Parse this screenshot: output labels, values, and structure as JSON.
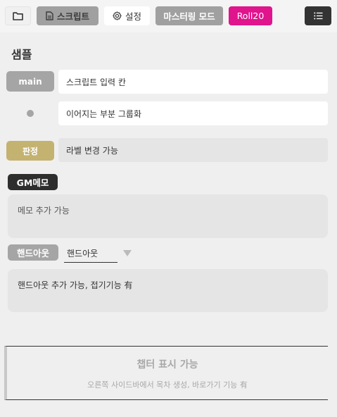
{
  "toolbar": {
    "folder_icon": "folder-icon",
    "script_label": "스크립트",
    "script_icon": "document-icon",
    "settings_label": "설정",
    "settings_icon": "gear-icon",
    "mastering_label": "마스터링 모드",
    "roll20_label": "Roll20",
    "list_icon": "list-icon"
  },
  "main": {
    "title": "샘플",
    "rows": [
      {
        "label": "main",
        "text": "스크립트 입력 칸"
      },
      {
        "label": "",
        "text": "이어지는 부분 그룹화"
      },
      {
        "label": "판정",
        "text": "라벨 변경 가능"
      }
    ],
    "gm_memo": {
      "label": "GM메모",
      "text": "메모 추가 가능"
    },
    "handout": {
      "label": "핸드아웃",
      "selected": "핸드아웃",
      "text": "핸드아웃 추가 가능, 접기기능 有"
    },
    "chapter": {
      "title": "챕터 표시 가능",
      "subtitle": "오른쪽 사이드바에서 목차 생성, 바로가기 기능 有"
    }
  },
  "colors": {
    "roll20": "#e0148c",
    "check_label": "#c4b270",
    "gray_label": "#a5a5a5",
    "dark": "#2e2e2e"
  }
}
